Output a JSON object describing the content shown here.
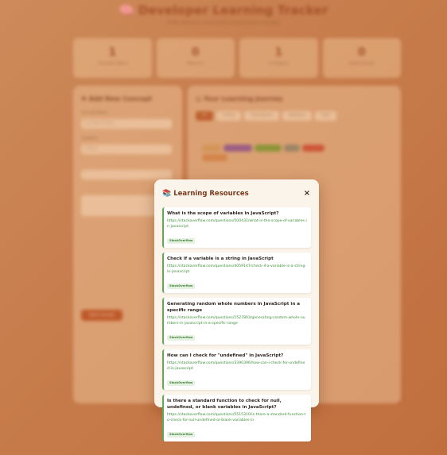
{
  "app": {
    "title": "Developer Learning Tracker",
    "subtitle": "Track, discover, and master programming concepts"
  },
  "stats": [
    {
      "value": "1",
      "label": "Concepts Added"
    },
    {
      "value": "0",
      "label": "Mastered"
    },
    {
      "value": "1",
      "label": "In Progress"
    },
    {
      "value": "0",
      "label": "Needs Review"
    }
  ],
  "add_concept": {
    "heading": "Add New Concept",
    "concept_label": "Concept Name",
    "concept_placeholder": "e.g. React Hooks",
    "category_label": "Category",
    "category_value": "Coding",
    "add_button": "Add Concept"
  },
  "journey": {
    "heading": "Your Learning Journey",
    "tabs": [
      "All",
      "Coding",
      "Frameworks",
      "Database",
      "Tools"
    ]
  },
  "modal": {
    "title": "Learning Resources",
    "close_label": "×",
    "resources": [
      {
        "title": "What is the scope of variables in JavaScript?",
        "url": "https://stackoverflow.com/questions/500431/what-is-the-scope-of-variables-in-javascript",
        "source": "StackOverflow"
      },
      {
        "title": "Check if a variable is a string in JavaScript",
        "url": "https://stackoverflow.com/questions/4059147/check-if-a-variable-is-a-string-in-javascript",
        "source": "StackOverflow"
      },
      {
        "title": "Generating random whole numbers in JavaScript in a specific range",
        "url": "https://stackoverflow.com/questions/1527803/generating-random-whole-numbers-in-javascript-in-a-specific-range",
        "source": "StackOverflow"
      },
      {
        "title": "How can I check for \"undefined\" in JavaScript?",
        "url": "https://stackoverflow.com/questions/3390396/how-can-i-check-for-undefined-in-javascript",
        "source": "StackOverflow"
      },
      {
        "title": "Is there a standard function to check for null, undefined, or blank variables in JavaScript?",
        "url": "https://stackoverflow.com/questions/5515310/is-there-a-standard-function-to-check-for-null-undefined-or-blank-variables-in",
        "source": "StackOverflow"
      }
    ]
  },
  "colors": {
    "accent": "#7a3a1e",
    "link": "#3f8f3a",
    "badge_bg": "#e6f2e1",
    "modal_bg": "#fbf4ea"
  }
}
